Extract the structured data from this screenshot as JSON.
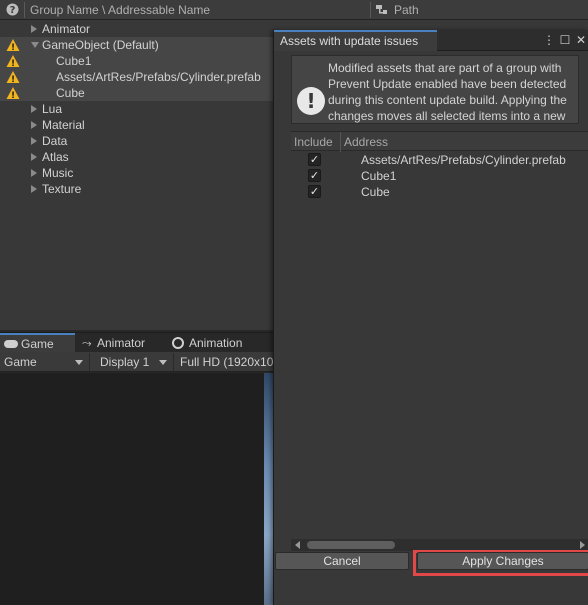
{
  "groups_panel": {
    "header": {
      "help_icon": "help-circle-icon",
      "group_column": "Group Name \\ Addressable Name",
      "path_icon": "path-icon",
      "path_column": "Path"
    },
    "tree": [
      {
        "label": "Animator",
        "expanded": false,
        "warning": false,
        "depth": 0
      },
      {
        "label": "GameObject (Default)",
        "expanded": true,
        "warning": true,
        "depth": 0
      },
      {
        "label": "Cube1",
        "warning": true,
        "depth": 1
      },
      {
        "label": "Assets/ArtRes/Prefabs/Cylinder.prefab",
        "warning": true,
        "depth": 1
      },
      {
        "label": "Cube",
        "warning": true,
        "depth": 1
      },
      {
        "label": "Lua",
        "expanded": false,
        "warning": false,
        "depth": 0
      },
      {
        "label": "Material",
        "expanded": false,
        "warning": false,
        "depth": 0
      },
      {
        "label": "Data",
        "expanded": false,
        "warning": false,
        "depth": 0
      },
      {
        "label": "Atlas",
        "expanded": false,
        "warning": false,
        "depth": 0
      },
      {
        "label": "Music",
        "expanded": false,
        "warning": false,
        "depth": 0
      },
      {
        "label": "Texture",
        "expanded": false,
        "warning": false,
        "depth": 0
      }
    ]
  },
  "game_view": {
    "tabs": [
      {
        "label": "Game",
        "icon": "gamepad-icon",
        "active": true
      },
      {
        "label": "Animator",
        "icon": "animator-icon",
        "active": false
      },
      {
        "label": "Animation",
        "icon": "animation-clock-icon",
        "active": false
      }
    ],
    "toolbar": {
      "mode": "Game",
      "display": "Display 1",
      "resolution": "Full HD (1920x10"
    }
  },
  "dialog": {
    "title": "Assets with update issues",
    "controls": {
      "menu": "⋮",
      "maximize": "☐",
      "close": "✕"
    },
    "info_icon": "exclamation-info-icon",
    "info_text": "Modified assets that are part of a group with Prevent Update enabled have been detected during this content update build. Applying the changes moves all selected items into a new group that has Prevent",
    "table": {
      "headers": {
        "include": "Include",
        "address": "Address"
      },
      "rows": [
        {
          "include": true,
          "address": "Assets/ArtRes/Prefabs/Cylinder.prefab"
        },
        {
          "include": true,
          "address": "Cube1"
        },
        {
          "include": true,
          "address": "Cube"
        }
      ]
    },
    "buttons": {
      "cancel": "Cancel",
      "apply": "Apply Changes"
    },
    "colors": {
      "accent_tab": "#4a7fc0",
      "highlight_outline": "#e0484a",
      "warning": "#f2b51e"
    }
  }
}
